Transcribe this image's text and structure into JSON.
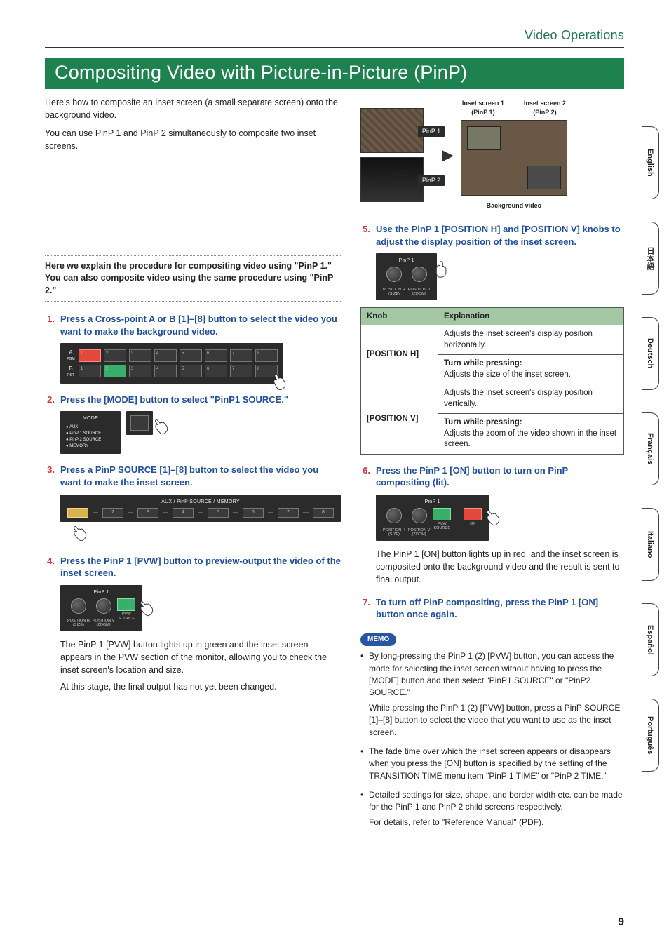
{
  "header": {
    "breadcrumb": "Video Operations",
    "title": "Compositing Video with Picture-in-Picture (PinP)"
  },
  "intro": {
    "p1": "Here's how to composite an inset screen (a small separate screen) onto the background video.",
    "p2": "You can use PinP 1 and PinP 2 simultaneously to composite two inset screens."
  },
  "diagram": {
    "pinp1": "PinP 1",
    "pinp2": "PinP 2",
    "inset1_a": "Inset screen 1",
    "inset1_b": "(PinP 1)",
    "inset2_a": "Inset screen 2",
    "inset2_b": "(PinP 2)",
    "bgvideo": "Background video"
  },
  "callout": "Here we explain the procedure for compositing video using \"PinP 1.\" You can also composite video using the same procedure using \"PinP 2.\"",
  "steps": {
    "s1": {
      "n": "1.",
      "t": "Press a Cross-point A or B [1]–[8] button to select the video you want to make the background video."
    },
    "s2": {
      "n": "2.",
      "t": "Press the [MODE] button to select \"PinP1 SOURCE.\""
    },
    "s3": {
      "n": "3.",
      "t": "Press a PinP SOURCE [1]–[8] button to select the video you want to make the inset screen."
    },
    "s4": {
      "n": "4.",
      "t": "Press the PinP 1 [PVW] button to preview-output the video of the inset screen.",
      "b1": "The PinP 1 [PVW] button lights up in green and the inset screen appears in the PVW section of the monitor, allowing you to check the inset screen's location and size.",
      "b2": "At this stage, the final output has not yet been changed."
    },
    "s5": {
      "n": "5.",
      "t": "Use the PinP 1 [POSITION H] and [POSITION V] knobs to adjust the display position of the inset screen."
    },
    "s6": {
      "n": "6.",
      "t": "Press the PinP 1 [ON] button to turn on PinP compositing (lit).",
      "b1": "The PinP 1 [ON] button lights up in red, and the inset screen is composited onto the background video and the result is sent to final output."
    },
    "s7": {
      "n": "7.",
      "t": "To turn off PinP compositing, press the PinP 1 [ON] button once again."
    }
  },
  "device": {
    "rowA": "A",
    "rowA_sub": "PGM",
    "rowB": "B",
    "rowB_sub": "PST",
    "mode": "MODE",
    "mode_items": [
      "AUX",
      "PinP 1 SOURCE",
      "PinP 2 SOURCE",
      "MEMORY"
    ],
    "aux_header": "AUX / PinP SOURCE / MEMORY",
    "pinp1_header": "PinP 1",
    "knob_h": "POSITION H",
    "knob_h_sub": "(SIZE)",
    "knob_v": "POSITION V",
    "knob_v_sub": "(ZOOM)",
    "pvw": "PVW",
    "pvw_sub": "SOURCE",
    "on": "ON",
    "nums": [
      "1",
      "2",
      "3",
      "4",
      "5",
      "6",
      "7",
      "8"
    ]
  },
  "table": {
    "h1": "Knob",
    "h2": "Explanation",
    "r1k": "[POSITION H]",
    "r1a": "Adjusts the inset screen's display position horizontally.",
    "r1b_title": "Turn while pressing:",
    "r1b": "Adjusts the size of the inset screen.",
    "r2k": "[POSITION V]",
    "r2a": "Adjusts the inset screen's display position vertically.",
    "r2b_title": "Turn while pressing:",
    "r2b": "Adjusts the zoom of the video shown in the inset screen."
  },
  "memo": {
    "label": "MEMO",
    "i1a": "By long-pressing the PinP 1 (2) [PVW] button, you can access the mode for selecting the inset screen without having to press the [MODE] button and then select \"PinP1 SOURCE\" or \"PinP2 SOURCE.\"",
    "i1b": "While pressing the PinP 1 (2) [PVW] button, press a PinP SOURCE [1]–[8] button to select the video that you want to use as the inset screen.",
    "i2": "The fade time over which the inset screen appears or disappears when you press the [ON] button is specified by the setting of the TRANSITION TIME menu item \"PinP 1 TIME\" or \"PinP 2 TIME.\"",
    "i3a": "Detailed settings for size, shape, and border width etc. can be made for the PinP 1 and PinP 2 child screens respectively.",
    "i3b": "For details, refer to \"Reference Manual\" (PDF)."
  },
  "tabs": [
    "English",
    "日本語",
    "Deutsch",
    "Français",
    "Italiano",
    "Español",
    "Português"
  ],
  "page_num": "9"
}
